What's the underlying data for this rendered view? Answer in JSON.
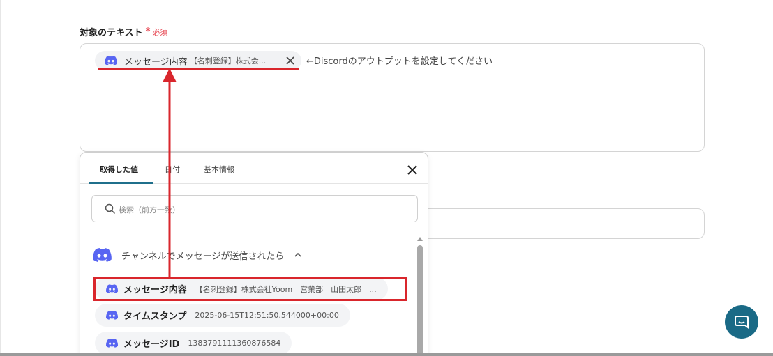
{
  "field": {
    "label": "対象のテキスト",
    "required_star": "*",
    "required_text": "必須",
    "hint": "←Discordのアウトプットを設定してください"
  },
  "chip": {
    "title": "メッセージ内容",
    "value": "【名刺登録】株式会...",
    "icon": "discord-icon"
  },
  "dropdown": {
    "tabs": [
      {
        "label": "取得した値",
        "active": true
      },
      {
        "label": "日付",
        "active": false
      },
      {
        "label": "基本情報",
        "active": false
      }
    ],
    "search_placeholder": "検索（前方一致）",
    "group": {
      "label": "チャンネルでメッセージが送信されたら",
      "expanded": true
    },
    "items": [
      {
        "title": "メッセージ内容",
        "value": "【名刺登録】株式会社Yoom　営業部　山田太郎　..."
      },
      {
        "title": "タイムスタンプ",
        "value": "2025-06-15T12:51:50.544000+00:00"
      },
      {
        "title": "メッセージID",
        "value": "1383791111360876584"
      }
    ]
  },
  "colors": {
    "accent": "#1f6f8b",
    "discord": "#5865f2",
    "required": "#e8505b",
    "annotation_red": "#d9262c",
    "chat_button": "#1a6a86"
  }
}
